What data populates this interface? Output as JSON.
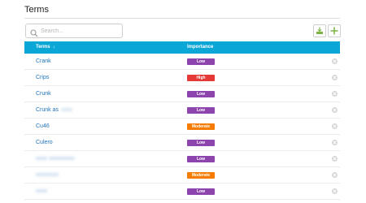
{
  "page": {
    "title": "Terms"
  },
  "search": {
    "placeholder": "Search..."
  },
  "toolbar": {
    "export_icon": "download-tray-icon",
    "add_icon": "plus-icon",
    "accent": "#7cb342"
  },
  "table": {
    "header_color": "#0aa6d6",
    "columns": [
      {
        "label": "Terms",
        "sort_icon": "↓"
      },
      {
        "label": "Importance"
      }
    ],
    "rows": [
      {
        "term": "Crank",
        "term_suffix": "",
        "importance": "Low"
      },
      {
        "term": "Crips",
        "term_suffix": "",
        "importance": "High"
      },
      {
        "term": "Crunk",
        "term_suffix": "",
        "importance": "Low"
      },
      {
        "term": "Crunk as",
        "term_suffix": "",
        "importance": "Low"
      },
      {
        "term": "Cu46",
        "term_suffix": "",
        "importance": "Moderate"
      },
      {
        "term": "Culero",
        "term_suffix": "",
        "importance": "Low"
      },
      {
        "term": "",
        "term_suffix": "",
        "importance": "Low"
      },
      {
        "term": "",
        "term_suffix": "",
        "importance": "Moderate"
      },
      {
        "term": "",
        "term_suffix": "",
        "importance": "Low"
      }
    ]
  },
  "importance_colors": {
    "Low": "#8e44ad",
    "High": "#e53935",
    "Moderate": "#f57c00"
  }
}
